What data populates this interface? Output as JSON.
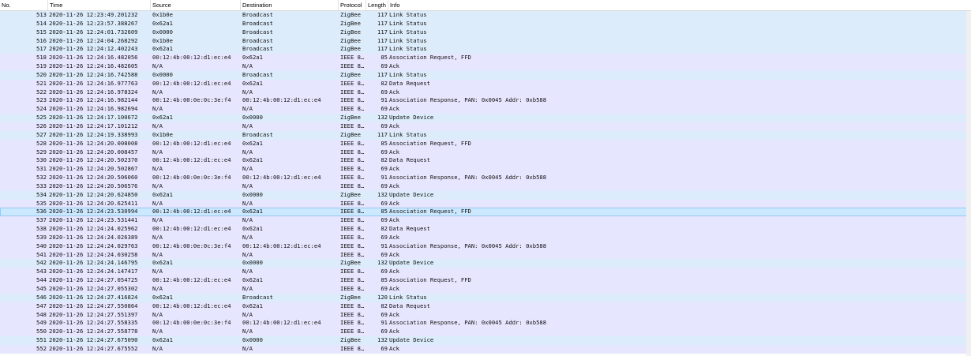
{
  "columns": {
    "no": "No.",
    "time": "Time",
    "source": "Source",
    "destination": "Destination",
    "protocol": "Protocol",
    "length": "Length",
    "info": "Info"
  },
  "colors": {
    "zigbee_row": "#dcecfb",
    "ieee_row": "#e7e6ff",
    "selected_row": "#cce8ff"
  },
  "selected_no": "536",
  "packets": [
    {
      "no": "513",
      "time": "2020-11-26 12:23:49.201232",
      "src": "0x1b0e",
      "dst": "Broadcast",
      "proto": "ZigBee",
      "len": "117",
      "info": "Link Status"
    },
    {
      "no": "514",
      "time": "2020-11-26 12:23:57.388267",
      "src": "0x62a1",
      "dst": "Broadcast",
      "proto": "ZigBee",
      "len": "117",
      "info": "Link Status"
    },
    {
      "no": "515",
      "time": "2020-11-26 12:24:01.732609",
      "src": "0x0000",
      "dst": "Broadcast",
      "proto": "ZigBee",
      "len": "117",
      "info": "Link Status"
    },
    {
      "no": "516",
      "time": "2020-11-26 12:24:04.268292",
      "src": "0x1b0e",
      "dst": "Broadcast",
      "proto": "ZigBee",
      "len": "117",
      "info": "Link Status"
    },
    {
      "no": "517",
      "time": "2020-11-26 12:24:12.402243",
      "src": "0x62a1",
      "dst": "Broadcast",
      "proto": "ZigBee",
      "len": "117",
      "info": "Link Status"
    },
    {
      "no": "518",
      "time": "2020-11-26 12:24:16.482056",
      "src": "00:12:4b:00:12:d1:ec:e4",
      "dst": "0x62a1",
      "proto": "IEEE 8…",
      "len": "85",
      "info": "Association Request, FFD"
    },
    {
      "no": "519",
      "time": "2020-11-26 12:24:16.482605",
      "src": "N/A",
      "dst": "N/A",
      "proto": "IEEE 8…",
      "len": "69",
      "info": "Ack"
    },
    {
      "no": "520",
      "time": "2020-11-26 12:24:16.742588",
      "src": "0x0000",
      "dst": "Broadcast",
      "proto": "ZigBee",
      "len": "117",
      "info": "Link Status"
    },
    {
      "no": "521",
      "time": "2020-11-26 12:24:16.977763",
      "src": "00:12:4b:00:12:d1:ec:e4",
      "dst": "0x62a1",
      "proto": "IEEE 8…",
      "len": "82",
      "info": "Data Request"
    },
    {
      "no": "522",
      "time": "2020-11-26 12:24:16.978324",
      "src": "N/A",
      "dst": "N/A",
      "proto": "IEEE 8…",
      "len": "69",
      "info": "Ack"
    },
    {
      "no": "523",
      "time": "2020-11-26 12:24:16.982144",
      "src": "00:12:4b:00:0e:0c:3e:f4",
      "dst": "00:12:4b:00:12:d1:ec:e4",
      "proto": "IEEE 8…",
      "len": "91",
      "info": "Association Response, PAN: 0x0045 Addr: 0xb588"
    },
    {
      "no": "524",
      "time": "2020-11-26 12:24:16.982694",
      "src": "N/A",
      "dst": "N/A",
      "proto": "IEEE 8…",
      "len": "69",
      "info": "Ack"
    },
    {
      "no": "525",
      "time": "2020-11-26 12:24:17.100672",
      "src": "0x62a1",
      "dst": "0x0000",
      "proto": "ZigBee",
      "len": "132",
      "info": "Update Device"
    },
    {
      "no": "526",
      "time": "2020-11-26 12:24:17.101212",
      "src": "N/A",
      "dst": "N/A",
      "proto": "IEEE 8…",
      "len": "69",
      "info": "Ack"
    },
    {
      "no": "527",
      "time": "2020-11-26 12:24:19.338993",
      "src": "0x1b0e",
      "dst": "Broadcast",
      "proto": "ZigBee",
      "len": "117",
      "info": "Link Status"
    },
    {
      "no": "528",
      "time": "2020-11-26 12:24:20.008008",
      "src": "00:12:4b:00:12:d1:ec:e4",
      "dst": "0x62a1",
      "proto": "IEEE 8…",
      "len": "85",
      "info": "Association Request, FFD"
    },
    {
      "no": "529",
      "time": "2020-11-26 12:24:20.008457",
      "src": "N/A",
      "dst": "N/A",
      "proto": "IEEE 8…",
      "len": "69",
      "info": "Ack"
    },
    {
      "no": "530",
      "time": "2020-11-26 12:24:20.502370",
      "src": "00:12:4b:00:12:d1:ec:e4",
      "dst": "0x62a1",
      "proto": "IEEE 8…",
      "len": "82",
      "info": "Data Request"
    },
    {
      "no": "531",
      "time": "2020-11-26 12:24:20.502867",
      "src": "N/A",
      "dst": "N/A",
      "proto": "IEEE 8…",
      "len": "69",
      "info": "Ack"
    },
    {
      "no": "532",
      "time": "2020-11-26 12:24:20.506060",
      "src": "00:12:4b:00:0e:0c:3e:f4",
      "dst": "00:12:4b:00:12:d1:ec:e4",
      "proto": "IEEE 8…",
      "len": "91",
      "info": "Association Response, PAN: 0x0045 Addr: 0xb588"
    },
    {
      "no": "533",
      "time": "2020-11-26 12:24:20.506576",
      "src": "N/A",
      "dst": "N/A",
      "proto": "IEEE 8…",
      "len": "69",
      "info": "Ack"
    },
    {
      "no": "534",
      "time": "2020-11-26 12:24:20.624850",
      "src": "0x62a1",
      "dst": "0x0000",
      "proto": "ZigBee",
      "len": "132",
      "info": "Update Device"
    },
    {
      "no": "535",
      "time": "2020-11-26 12:24:20.625411",
      "src": "N/A",
      "dst": "N/A",
      "proto": "IEEE 8…",
      "len": "69",
      "info": "Ack"
    },
    {
      "no": "536",
      "time": "2020-11-26 12:24:23.530994",
      "src": "00:12:4b:00:12:d1:ec:e4",
      "dst": "0x62a1",
      "proto": "IEEE 8…",
      "len": "85",
      "info": "Association Request, FFD"
    },
    {
      "no": "537",
      "time": "2020-11-26 12:24:23.531441",
      "src": "N/A",
      "dst": "N/A",
      "proto": "IEEE 8…",
      "len": "69",
      "info": "Ack"
    },
    {
      "no": "538",
      "time": "2020-11-26 12:24:24.025962",
      "src": "00:12:4b:00:12:d1:ec:e4",
      "dst": "0x62a1",
      "proto": "IEEE 8…",
      "len": "82",
      "info": "Data Request"
    },
    {
      "no": "539",
      "time": "2020-11-26 12:24:24.026389",
      "src": "N/A",
      "dst": "N/A",
      "proto": "IEEE 8…",
      "len": "69",
      "info": "Ack"
    },
    {
      "no": "540",
      "time": "2020-11-26 12:24:24.029763",
      "src": "00:12:4b:00:0e:0c:3e:f4",
      "dst": "00:12:4b:00:12:d1:ec:e4",
      "proto": "IEEE 8…",
      "len": "91",
      "info": "Association Response, PAN: 0x0045 Addr: 0xb588"
    },
    {
      "no": "541",
      "time": "2020-11-26 12:24:24.030258",
      "src": "N/A",
      "dst": "N/A",
      "proto": "IEEE 8…",
      "len": "69",
      "info": "Ack"
    },
    {
      "no": "542",
      "time": "2020-11-26 12:24:24.146795",
      "src": "0x62a1",
      "dst": "0x0000",
      "proto": "ZigBee",
      "len": "132",
      "info": "Update Device"
    },
    {
      "no": "543",
      "time": "2020-11-26 12:24:24.147417",
      "src": "N/A",
      "dst": "N/A",
      "proto": "IEEE 8…",
      "len": "69",
      "info": "Ack"
    },
    {
      "no": "544",
      "time": "2020-11-26 12:24:27.054725",
      "src": "00:12:4b:00:12:d1:ec:e4",
      "dst": "0x62a1",
      "proto": "IEEE 8…",
      "len": "85",
      "info": "Association Request, FFD"
    },
    {
      "no": "545",
      "time": "2020-11-26 12:24:27.055302",
      "src": "N/A",
      "dst": "N/A",
      "proto": "IEEE 8…",
      "len": "69",
      "info": "Ack"
    },
    {
      "no": "546",
      "time": "2020-11-26 12:24:27.416824",
      "src": "0x62a1",
      "dst": "Broadcast",
      "proto": "ZigBee",
      "len": "120",
      "info": "Link Status"
    },
    {
      "no": "547",
      "time": "2020-11-26 12:24:27.550864",
      "src": "00:12:4b:00:12:d1:ec:e4",
      "dst": "0x62a1",
      "proto": "IEEE 8…",
      "len": "82",
      "info": "Data Request"
    },
    {
      "no": "548",
      "time": "2020-11-26 12:24:27.551397",
      "src": "N/A",
      "dst": "N/A",
      "proto": "IEEE 8…",
      "len": "69",
      "info": "Ack"
    },
    {
      "no": "549",
      "time": "2020-11-26 12:24:27.558335",
      "src": "00:12:4b:00:0e:0c:3e:f4",
      "dst": "00:12:4b:00:12:d1:ec:e4",
      "proto": "IEEE 8…",
      "len": "91",
      "info": "Association Response, PAN: 0x0045 Addr: 0xb588"
    },
    {
      "no": "550",
      "time": "2020-11-26 12:24:27.558778",
      "src": "N/A",
      "dst": "N/A",
      "proto": "IEEE 8…",
      "len": "69",
      "info": "Ack"
    },
    {
      "no": "551",
      "time": "2020-11-26 12:24:27.675090",
      "src": "0x62a1",
      "dst": "0x0000",
      "proto": "ZigBee",
      "len": "132",
      "info": "Update Device"
    },
    {
      "no": "552",
      "time": "2020-11-26 12:24:27.675552",
      "src": "N/A",
      "dst": "N/A",
      "proto": "IEEE 8…",
      "len": "69",
      "info": "Ack"
    }
  ]
}
